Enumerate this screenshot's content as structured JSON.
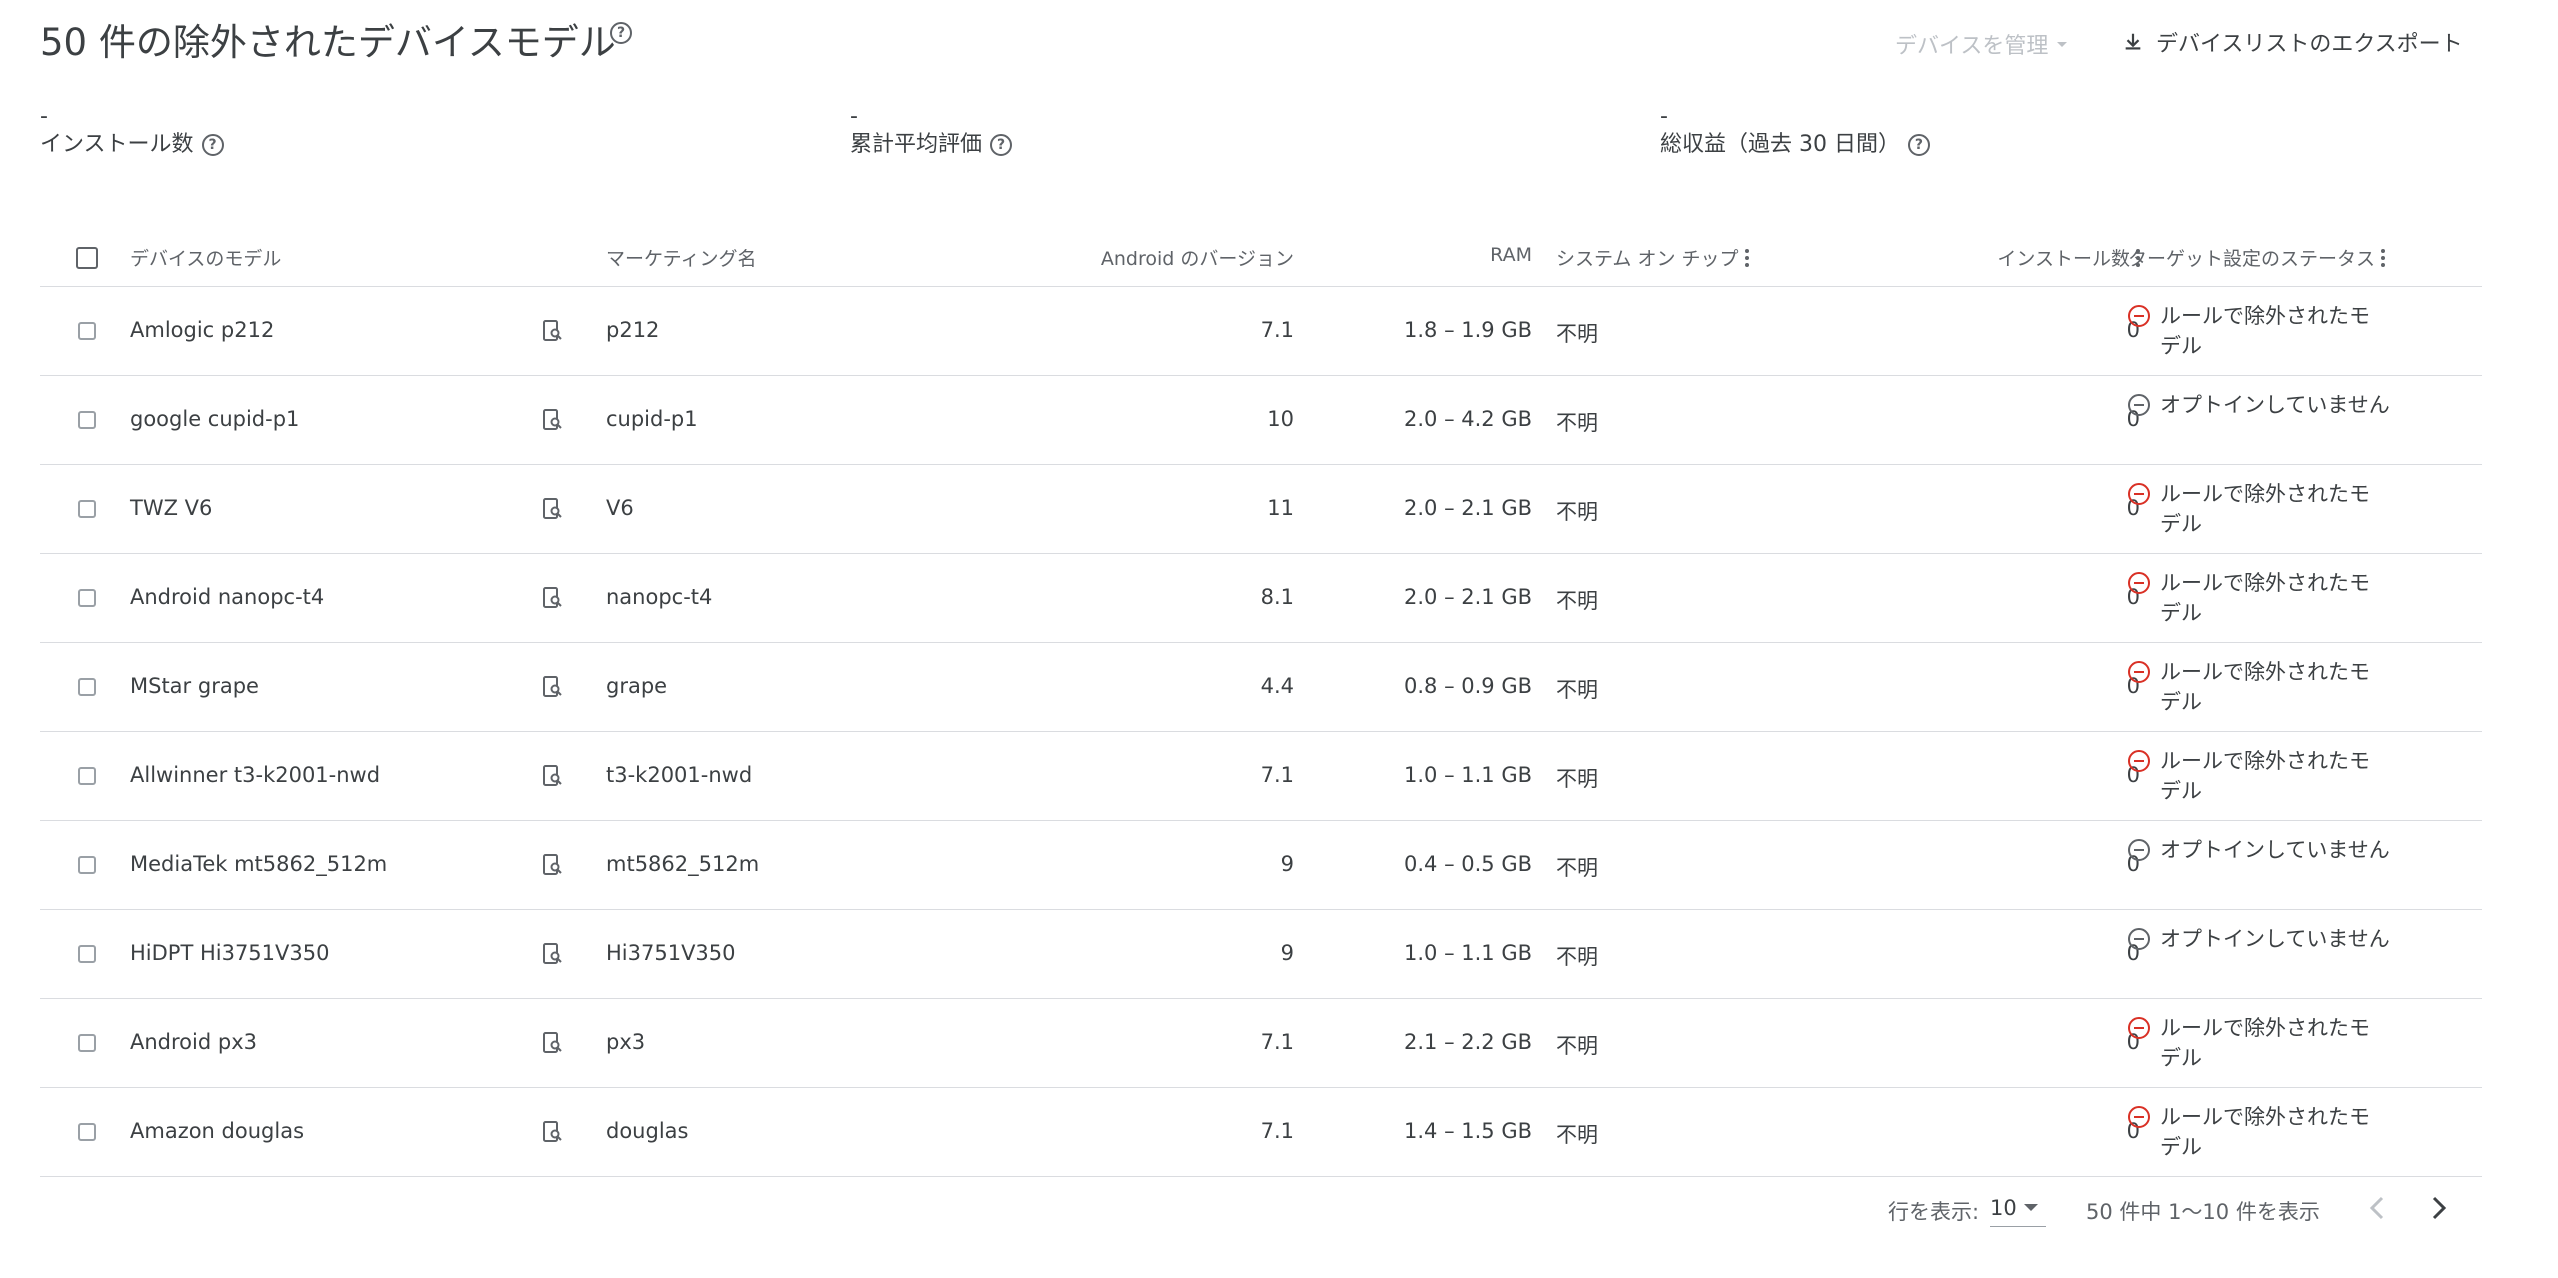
{
  "header": {
    "title": "50 件の除外されたデバイスモデル",
    "manage_label": "デバイスを管理",
    "export_label": "デバイスリストのエクスポート"
  },
  "stats": [
    {
      "value": "-",
      "label": "インストール数"
    },
    {
      "value": "-",
      "label": "累計平均評価"
    },
    {
      "value": "-",
      "label": "総収益（過去 30 日間）"
    }
  ],
  "table": {
    "columns": {
      "model": "デバイスのモデル",
      "marketing": "マーケティング名",
      "android": "Android のバージョン",
      "ram": "RAM",
      "soc": "システム オン チップ",
      "installs": "インストール数",
      "status": "ターゲット設定のステータス"
    },
    "rows": [
      {
        "model": "Amlogic p212",
        "marketing": "p212",
        "android": "7.1",
        "ram": "1.8 – 1.9 GB",
        "soc": "不明",
        "installs": "0",
        "status": "ルールで除外されたモデル",
        "status_type": "excluded"
      },
      {
        "model": "google cupid-p1",
        "marketing": "cupid-p1",
        "android": "10",
        "ram": "2.0 – 4.2 GB",
        "soc": "不明",
        "installs": "0",
        "status": "オプトインしていません",
        "status_type": "neutral"
      },
      {
        "model": "TWZ V6",
        "marketing": "V6",
        "android": "11",
        "ram": "2.0 – 2.1 GB",
        "soc": "不明",
        "installs": "0",
        "status": "ルールで除外されたモデル",
        "status_type": "excluded"
      },
      {
        "model": "Android nanopc-t4",
        "marketing": "nanopc-t4",
        "android": "8.1",
        "ram": "2.0 – 2.1 GB",
        "soc": "不明",
        "installs": "0",
        "status": "ルールで除外されたモデル",
        "status_type": "excluded"
      },
      {
        "model": "MStar grape",
        "marketing": "grape",
        "android": "4.4",
        "ram": "0.8 – 0.9 GB",
        "soc": "不明",
        "installs": "0",
        "status": "ルールで除外されたモデル",
        "status_type": "excluded"
      },
      {
        "model": "Allwinner t3-k2001-nwd",
        "marketing": "t3-k2001-nwd",
        "android": "7.1",
        "ram": "1.0 – 1.1 GB",
        "soc": "不明",
        "installs": "0",
        "status": "ルールで除外されたモデル",
        "status_type": "excluded"
      },
      {
        "model": "MediaTek mt5862_512m",
        "marketing": "mt5862_512m",
        "android": "9",
        "ram": "0.4 – 0.5 GB",
        "soc": "不明",
        "installs": "0",
        "status": "オプトインしていません",
        "status_type": "neutral"
      },
      {
        "model": "HiDPT Hi3751V350",
        "marketing": "Hi3751V350",
        "android": "9",
        "ram": "1.0 – 1.1 GB",
        "soc": "不明",
        "installs": "0",
        "status": "オプトインしていません",
        "status_type": "neutral"
      },
      {
        "model": "Android px3",
        "marketing": "px3",
        "android": "7.1",
        "ram": "2.1 – 2.2 GB",
        "soc": "不明",
        "installs": "0",
        "status": "ルールで除外されたモデル",
        "status_type": "excluded"
      },
      {
        "model": "Amazon douglas",
        "marketing": "douglas",
        "android": "7.1",
        "ram": "1.4 – 1.5 GB",
        "soc": "不明",
        "installs": "0",
        "status": "ルールで除外されたモデル",
        "status_type": "excluded"
      }
    ]
  },
  "pagination": {
    "rows_label": "行を表示:",
    "rows_value": "10",
    "range_label": "50 件中 1〜10 件を表示"
  },
  "colors": {
    "excluded": "#d93025",
    "neutral": "#5f6368"
  }
}
